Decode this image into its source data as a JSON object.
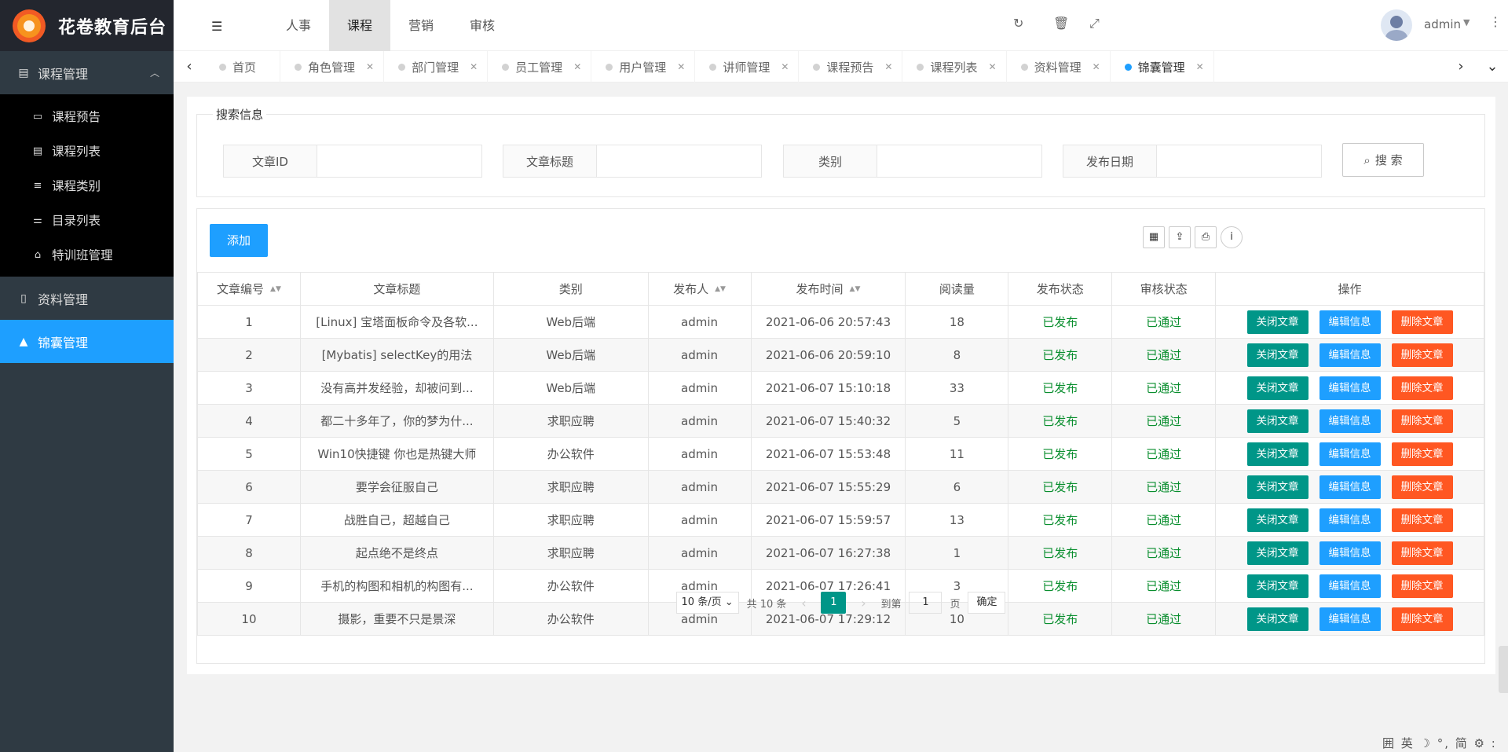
{
  "app": {
    "title": "花卷教育后台"
  },
  "sidebar": {
    "groups": [
      {
        "label": "课程管理",
        "icon": "book-icon",
        "expanded": true,
        "children": [
          {
            "label": "课程预告",
            "icon": "preview-icon"
          },
          {
            "label": "课程列表",
            "icon": "list-icon"
          },
          {
            "label": "课程类别",
            "icon": "menu-icon"
          },
          {
            "label": "目录列表",
            "icon": "sliders-icon"
          },
          {
            "label": "特训班管理",
            "icon": "bank-icon"
          }
        ]
      },
      {
        "label": "资料管理",
        "icon": "document-icon"
      },
      {
        "label": "锦囊管理",
        "icon": "chart-icon",
        "active": true
      }
    ]
  },
  "header": {
    "topnav": [
      "人事",
      "课程",
      "营销",
      "审核"
    ],
    "topnav_active": "课程",
    "user": "admin"
  },
  "tabs": [
    {
      "label": "首页",
      "closable": false
    },
    {
      "label": "角色管理",
      "closable": true
    },
    {
      "label": "部门管理",
      "closable": true
    },
    {
      "label": "员工管理",
      "closable": true
    },
    {
      "label": "用户管理",
      "closable": true
    },
    {
      "label": "讲师管理",
      "closable": true
    },
    {
      "label": "课程预告",
      "closable": true
    },
    {
      "label": "课程列表",
      "closable": true
    },
    {
      "label": "资料管理",
      "closable": true
    },
    {
      "label": "锦囊管理",
      "closable": true,
      "active": true
    }
  ],
  "search": {
    "legend": "搜索信息",
    "fields": [
      {
        "label": "文章ID",
        "value": ""
      },
      {
        "label": "文章标题",
        "value": ""
      },
      {
        "label": "类别",
        "value": ""
      },
      {
        "label": "发布日期",
        "value": ""
      }
    ],
    "button": "搜 索"
  },
  "toolbar": {
    "add": "添加"
  },
  "table": {
    "headers": [
      "文章编号",
      "文章标题",
      "类别",
      "发布人",
      "发布时间",
      "阅读量",
      "发布状态",
      "审核状态",
      "操作"
    ],
    "sortable": [
      true,
      false,
      false,
      true,
      true,
      false,
      false,
      false,
      false
    ],
    "actions": [
      "关闭文章",
      "编辑信息",
      "删除文章"
    ],
    "rows": [
      [
        "1",
        "[Linux] 宝塔面板命令及各软...",
        "Web后端",
        "admin",
        "2021-06-06 20:57:43",
        "18",
        "已发布",
        "已通过"
      ],
      [
        "2",
        "[Mybatis] selectKey的用法",
        "Web后端",
        "admin",
        "2021-06-06 20:59:10",
        "8",
        "已发布",
        "已通过"
      ],
      [
        "3",
        "没有高并发经验，却被问到...",
        "Web后端",
        "admin",
        "2021-06-07 15:10:18",
        "33",
        "已发布",
        "已通过"
      ],
      [
        "4",
        "都二十多年了，你的梦为什...",
        "求职应聘",
        "admin",
        "2021-06-07 15:40:32",
        "5",
        "已发布",
        "已通过"
      ],
      [
        "5",
        "Win10快捷键 你也是热键大师",
        "办公软件",
        "admin",
        "2021-06-07 15:53:48",
        "11",
        "已发布",
        "已通过"
      ],
      [
        "6",
        "要学会征服自己",
        "求职应聘",
        "admin",
        "2021-06-07 15:55:29",
        "6",
        "已发布",
        "已通过"
      ],
      [
        "7",
        "战胜自己，超越自己",
        "求职应聘",
        "admin",
        "2021-06-07 15:59:57",
        "13",
        "已发布",
        "已通过"
      ],
      [
        "8",
        "起点绝不是终点",
        "求职应聘",
        "admin",
        "2021-06-07 16:27:38",
        "1",
        "已发布",
        "已通过"
      ],
      [
        "9",
        "手机的构图和相机的构图有...",
        "办公软件",
        "admin",
        "2021-06-07 17:26:41",
        "3",
        "已发布",
        "已通过"
      ],
      [
        "10",
        "摄影，重要不只是景深",
        "办公软件",
        "admin",
        "2021-06-07 17:29:12",
        "10",
        "已发布",
        "已通过"
      ]
    ]
  },
  "pagination": {
    "page_size": "10 条/页",
    "total": "共 10 条",
    "current": "1",
    "goto_label": "到第",
    "goto_value": "1",
    "page_unit": "页",
    "confirm": "确定"
  },
  "ime": "囲 英 ☽ °, 简 ⚙ :"
}
